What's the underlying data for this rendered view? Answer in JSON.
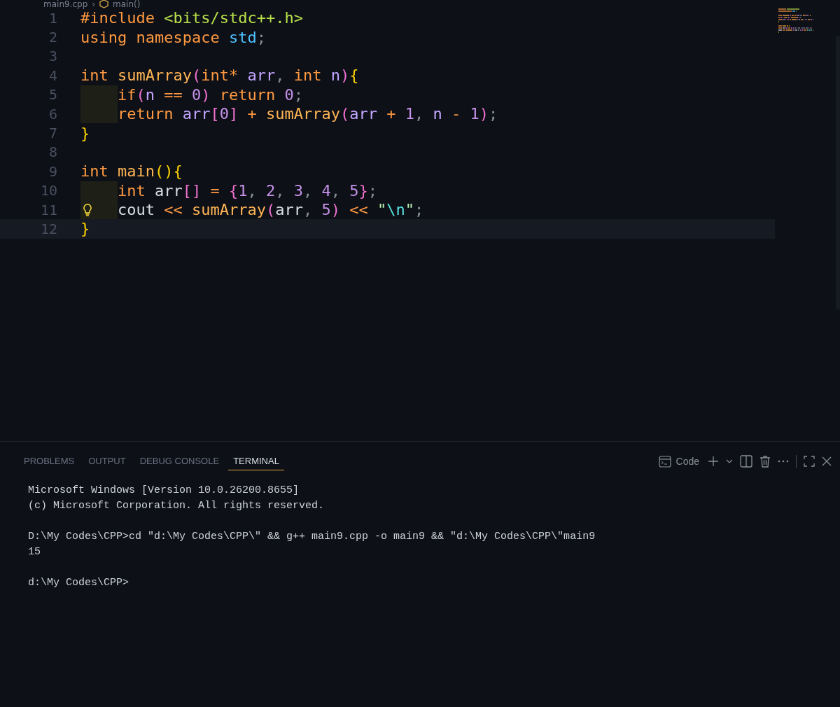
{
  "breadcrumb": {
    "file": "main9.cpp",
    "separator": "›",
    "symbol": "main()"
  },
  "editor": {
    "lines": [
      {
        "number": "1",
        "current": false,
        "indent": false,
        "lightbulb": false,
        "tokens": [
          {
            "text": "#include ",
            "kind": "keyword"
          },
          {
            "text": "<bits/stdc++.h>",
            "kind": "header"
          }
        ]
      },
      {
        "number": "2",
        "current": false,
        "indent": false,
        "lightbulb": false,
        "tokens": [
          {
            "text": "using namespace ",
            "kind": "keyword"
          },
          {
            "text": "std",
            "kind": "namespace"
          },
          {
            "text": ";",
            "kind": "punct"
          }
        ]
      },
      {
        "number": "3",
        "current": false,
        "indent": false,
        "lightbulb": false
      },
      {
        "number": "4",
        "current": false,
        "indent": false,
        "lightbulb": false,
        "tokens": [
          {
            "text": "int ",
            "kind": "keyword"
          },
          {
            "text": "sumArray",
            "kind": "function"
          },
          {
            "text": "(",
            "kind": "paren"
          },
          {
            "text": "int",
            "kind": "keyword"
          },
          {
            "text": "* ",
            "kind": "op"
          },
          {
            "text": "arr",
            "kind": "param"
          },
          {
            "text": ", ",
            "kind": "punct"
          },
          {
            "text": "int ",
            "kind": "keyword"
          },
          {
            "text": "n",
            "kind": "param"
          },
          {
            "text": ")",
            "kind": "paren"
          },
          {
            "text": "{",
            "kind": "brace"
          }
        ]
      },
      {
        "number": "5",
        "current": false,
        "indent": true,
        "lightbulb": false,
        "tokens": [
          {
            "text": "if",
            "kind": "keyword"
          },
          {
            "text": "(",
            "kind": "paren"
          },
          {
            "text": "n",
            "kind": "param"
          },
          {
            "text": " == ",
            "kind": "op"
          },
          {
            "text": "0",
            "kind": "number"
          },
          {
            "text": ")",
            "kind": "paren"
          },
          {
            "text": " return ",
            "kind": "keyword"
          },
          {
            "text": "0",
            "kind": "number"
          },
          {
            "text": ";",
            "kind": "punct"
          }
        ]
      },
      {
        "number": "6",
        "current": false,
        "indent": true,
        "lightbulb": false,
        "tokens": [
          {
            "text": "return ",
            "kind": "keyword"
          },
          {
            "text": "arr",
            "kind": "param"
          },
          {
            "text": "[",
            "kind": "paren"
          },
          {
            "text": "0",
            "kind": "number"
          },
          {
            "text": "]",
            "kind": "paren"
          },
          {
            "text": " + ",
            "kind": "op"
          },
          {
            "text": "sumArray",
            "kind": "function"
          },
          {
            "text": "(",
            "kind": "paren"
          },
          {
            "text": "arr",
            "kind": "param"
          },
          {
            "text": " + ",
            "kind": "op"
          },
          {
            "text": "1",
            "kind": "number"
          },
          {
            "text": ", ",
            "kind": "punct"
          },
          {
            "text": "n",
            "kind": "param"
          },
          {
            "text": " - ",
            "kind": "op"
          },
          {
            "text": "1",
            "kind": "number"
          },
          {
            "text": ")",
            "kind": "paren"
          },
          {
            "text": ";",
            "kind": "punct"
          }
        ]
      },
      {
        "number": "7",
        "current": false,
        "indent": false,
        "lightbulb": false,
        "tokens": [
          {
            "text": "}",
            "kind": "brace"
          }
        ]
      },
      {
        "number": "8",
        "current": false,
        "indent": false,
        "lightbulb": false
      },
      {
        "number": "9",
        "current": false,
        "indent": false,
        "lightbulb": false,
        "tokens": [
          {
            "text": "int ",
            "kind": "keyword"
          },
          {
            "text": "main",
            "kind": "function"
          },
          {
            "text": "()",
            "kind": "brace"
          },
          {
            "text": "{",
            "kind": "brace"
          }
        ]
      },
      {
        "number": "10",
        "current": false,
        "indent": true,
        "lightbulb": false,
        "tokens": [
          {
            "text": "int ",
            "kind": "keyword"
          },
          {
            "text": "arr",
            "kind": "plain"
          },
          {
            "text": "[]",
            "kind": "paren"
          },
          {
            "text": " = ",
            "kind": "op"
          },
          {
            "text": "{",
            "kind": "paren"
          },
          {
            "text": "1",
            "kind": "number"
          },
          {
            "text": ", ",
            "kind": "punct"
          },
          {
            "text": "2",
            "kind": "number"
          },
          {
            "text": ", ",
            "kind": "punct"
          },
          {
            "text": "3",
            "kind": "number"
          },
          {
            "text": ", ",
            "kind": "punct"
          },
          {
            "text": "4",
            "kind": "number"
          },
          {
            "text": ", ",
            "kind": "punct"
          },
          {
            "text": "5",
            "kind": "number"
          },
          {
            "text": "}",
            "kind": "paren"
          },
          {
            "text": ";",
            "kind": "punct"
          }
        ]
      },
      {
        "number": "11",
        "current": false,
        "indent": true,
        "lightbulb": true,
        "tokens": [
          {
            "text": "cout",
            "kind": "plain"
          },
          {
            "text": " << ",
            "kind": "op"
          },
          {
            "text": "sumArray",
            "kind": "function"
          },
          {
            "text": "(",
            "kind": "paren"
          },
          {
            "text": "arr",
            "kind": "plain"
          },
          {
            "text": ", ",
            "kind": "punct"
          },
          {
            "text": "5",
            "kind": "number"
          },
          {
            "text": ")",
            "kind": "paren"
          },
          {
            "text": " << ",
            "kind": "op"
          },
          {
            "text": "\"",
            "kind": "string"
          },
          {
            "text": "\\n",
            "kind": "escape"
          },
          {
            "text": "\"",
            "kind": "string"
          },
          {
            "text": ";",
            "kind": "punct"
          }
        ]
      },
      {
        "number": "12",
        "current": true,
        "indent": false,
        "lightbulb": false,
        "tokens": [
          {
            "text": "}",
            "kind": "brace"
          }
        ]
      }
    ]
  },
  "panel": {
    "tabs": [
      {
        "label": "PROBLEMS",
        "selected": false
      },
      {
        "label": "OUTPUT",
        "selected": false
      },
      {
        "label": "DEBUG CONSOLE",
        "selected": false
      },
      {
        "label": "TERMINAL",
        "selected": true
      }
    ],
    "terminal_name": "Code",
    "terminal_blocks": [
      [
        "Microsoft Windows [Version 10.0.26200.8655]",
        "(c) Microsoft Corporation. All rights reserved."
      ],
      [
        "D:\\My Codes\\CPP>cd \"d:\\My Codes\\CPP\\\" && g++ main9.cpp -o main9 && \"d:\\My Codes\\CPP\\\"main9",
        "15"
      ],
      [
        "d:\\My Codes\\CPP>"
      ]
    ]
  }
}
